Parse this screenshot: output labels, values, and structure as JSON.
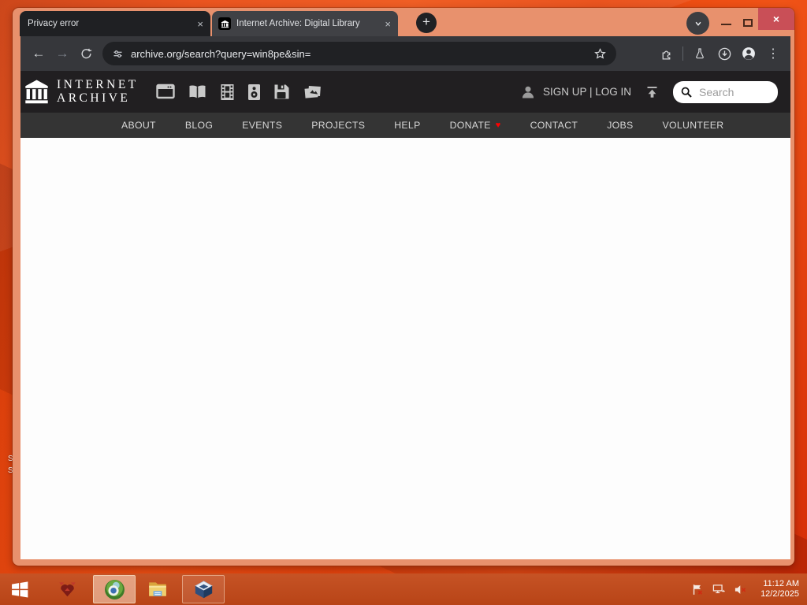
{
  "browser": {
    "tabs": [
      {
        "title": "Privacy error"
      },
      {
        "title": "Internet Archive: Digital Library"
      }
    ],
    "url": "archive.org/search?query=win8pe&sin="
  },
  "icons": {
    "close": "×",
    "plus": "+",
    "back": "←",
    "forward": "→",
    "kebab": "⋮",
    "heart": "♥"
  },
  "ia": {
    "logo": {
      "line1": "INTERNET",
      "line2": "ARCHIVE"
    },
    "account": {
      "signup_login": "SIGN UP | LOG IN"
    },
    "search": {
      "placeholder": "Search"
    },
    "nav": [
      "ABOUT",
      "BLOG",
      "EVENTS",
      "PROJECTS",
      "HELP",
      "DONATE",
      "CONTACT",
      "JOBS",
      "VOLUNTEER"
    ]
  },
  "taskbar": {
    "clock": {
      "time": "11:12 AM",
      "date": "12/2/2025"
    }
  },
  "desktop": {
    "fragments": [
      "S",
      "S"
    ]
  },
  "colors": {
    "accent_orange": "#e8470e",
    "window_frame": "#e8916d",
    "toolbar_dark": "#36373b",
    "ia_header": "#211f21",
    "close_red": "#c94f57",
    "donate_heart": "#ff0000"
  }
}
